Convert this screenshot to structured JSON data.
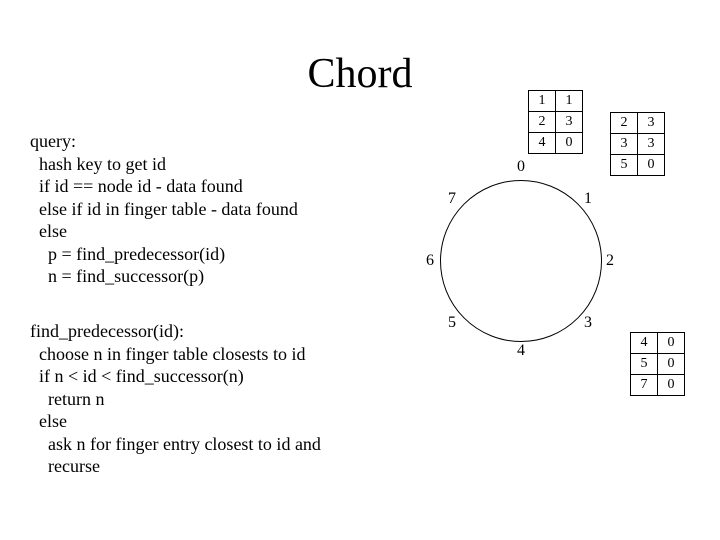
{
  "title": "Chord",
  "pseudo_query": "query:\n  hash key to get id\n  if id == node id - data found\n  else if id in finger table - data found\n  else\n    p = find_predecessor(id)\n    n = find_successor(p)",
  "pseudo_find": "find_predecessor(id):\n  choose n in finger table closests to id\n  if n < id < find_successor(n)\n    return n\n  else\n    ask n for finger entry closest to id and\n    recurse",
  "ring_labels": {
    "n0": "0",
    "n1": "1",
    "n2": "2",
    "n3": "3",
    "n4": "4",
    "n5": "5",
    "n6": "6",
    "n7": "7"
  },
  "finger0": {
    "r1c1": "1",
    "r1c2": "1",
    "r2c1": "2",
    "r2c2": "3",
    "r3c1": "4",
    "r3c2": "0"
  },
  "finger1": {
    "r1c1": "2",
    "r1c2": "3",
    "r2c1": "3",
    "r2c2": "3",
    "r3c1": "5",
    "r3c2": "0"
  },
  "finger3": {
    "r1c1": "4",
    "r1c2": "0",
    "r2c1": "5",
    "r2c2": "0",
    "r3c1": "7",
    "r3c2": "0"
  }
}
